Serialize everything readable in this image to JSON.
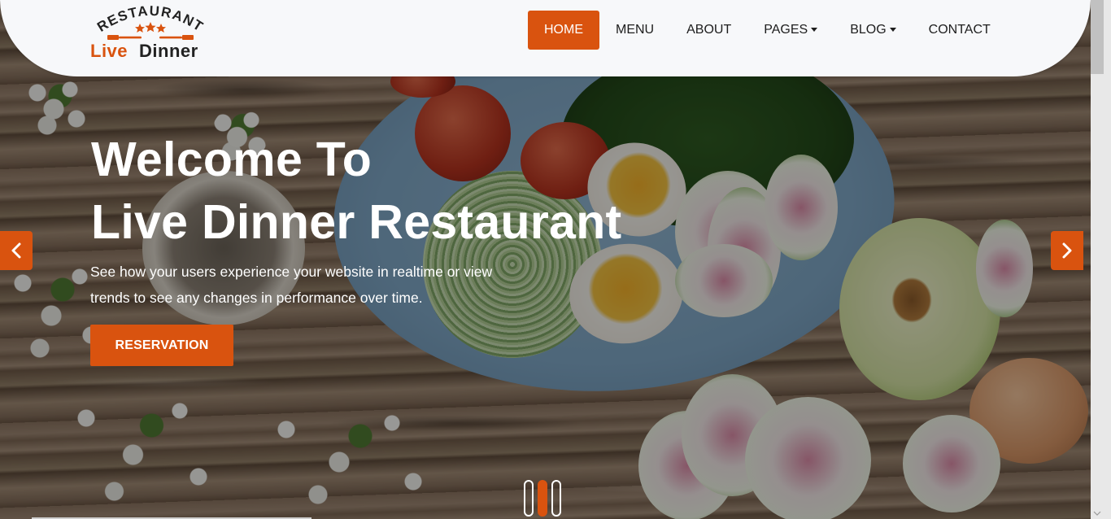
{
  "brand": {
    "arc_text": "RESTAURANT",
    "name_accent": "Live",
    "name_main": "Dinner",
    "stars": 3,
    "accent_color": "#d9530f"
  },
  "nav": {
    "items": [
      {
        "label": "HOME",
        "active": true,
        "dropdown": false
      },
      {
        "label": "MENU",
        "active": false,
        "dropdown": false
      },
      {
        "label": "ABOUT",
        "active": false,
        "dropdown": false
      },
      {
        "label": "PAGES",
        "active": false,
        "dropdown": true
      },
      {
        "label": "BLOG",
        "active": false,
        "dropdown": true
      },
      {
        "label": "CONTACT",
        "active": false,
        "dropdown": false
      }
    ]
  },
  "hero": {
    "title_line1": "Welcome To",
    "title_line2": "Live Dinner Restaurant",
    "subtitle_line1": "See how your users experience your website in realtime or view",
    "subtitle_line2": "trends to see any changes in performance over time.",
    "cta_label": "RESERVATION",
    "prev_icon": "chevron-left-icon",
    "next_icon": "chevron-right-icon"
  },
  "carousel": {
    "slide_count": 3,
    "active_index": 1
  }
}
